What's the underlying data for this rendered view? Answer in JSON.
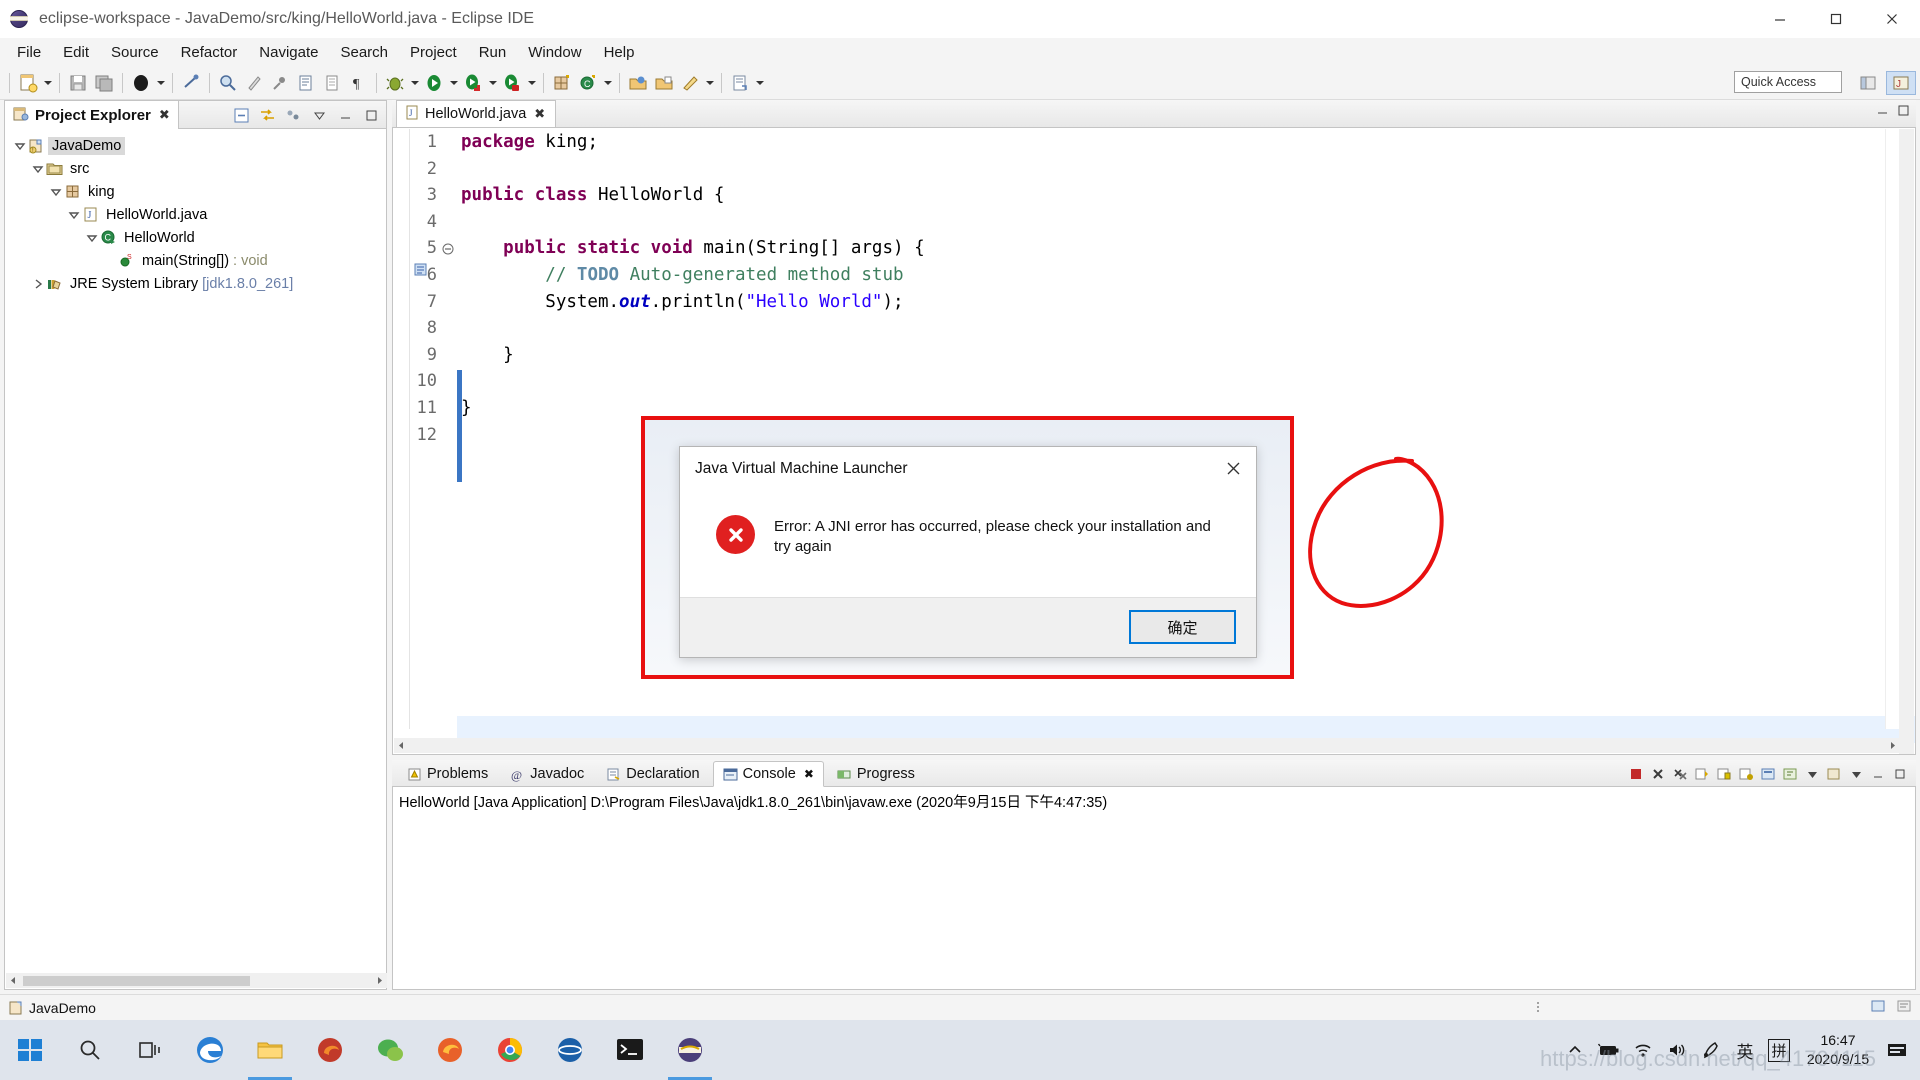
{
  "window": {
    "title": "eclipse-workspace - JavaDemo/src/king/HelloWorld.java - Eclipse IDE",
    "minimize": "–",
    "maximize": "❐",
    "close": "✕"
  },
  "menubar": {
    "items": [
      "File",
      "Edit",
      "Source",
      "Refactor",
      "Navigate",
      "Search",
      "Project",
      "Run",
      "Window",
      "Help"
    ]
  },
  "toolbar": {
    "quick_access": "Quick Access"
  },
  "project_explorer": {
    "tab_label": "Project Explorer",
    "close_glyph": "✖",
    "tree": [
      {
        "label": "JavaDemo",
        "indent": 0,
        "icon": "java-project-icon",
        "expanded": true,
        "selected": true
      },
      {
        "label": "src",
        "indent": 1,
        "icon": "source-folder-icon",
        "expanded": true,
        "selected": false
      },
      {
        "label": "king",
        "indent": 2,
        "icon": "package-icon",
        "expanded": true,
        "selected": false
      },
      {
        "label": "HelloWorld.java",
        "indent": 3,
        "icon": "java-file-icon",
        "expanded": true,
        "selected": false
      },
      {
        "label": "HelloWorld",
        "indent": 4,
        "icon": "java-class-icon",
        "expanded": true,
        "selected": false
      },
      {
        "label": "main(String[])",
        "suffix": " : void",
        "indent": 5,
        "icon": "method-static-icon",
        "expanded": null,
        "selected": false
      },
      {
        "label": "JRE System Library ",
        "suffix": "[jdk1.8.0_261]",
        "indent": 1,
        "icon": "library-icon",
        "expanded": false,
        "selected": false
      }
    ]
  },
  "editor": {
    "tab_label": "HelloWorld.java",
    "close_glyph": "✖",
    "lines": [
      {
        "n": "1",
        "html": "<span class='kw'>package</span> king;"
      },
      {
        "n": "2",
        "html": ""
      },
      {
        "n": "3",
        "html": "<span class='kw'>public class</span> HelloWorld {"
      },
      {
        "n": "4",
        "html": ""
      },
      {
        "n": "5",
        "html": "    <span class='kw'>public static void</span> main(String[] args) {"
      },
      {
        "n": "6",
        "html": "        <span class='cm'>// </span><span class='todo'>TODO</span><span class='cm'> Auto-generated method stub</span>"
      },
      {
        "n": "7",
        "html": "        System.<span class='fld'>out</span>.println(<span class='str'>\"Hello World\"</span>);"
      },
      {
        "n": "8",
        "html": ""
      },
      {
        "n": "9",
        "html": "    }"
      },
      {
        "n": "10",
        "html": ""
      },
      {
        "n": "11",
        "html": "}"
      },
      {
        "n": "12",
        "html": ""
      }
    ]
  },
  "bottom_panel": {
    "tabs": [
      {
        "label": "Problems",
        "icon": "problems-icon",
        "active": false
      },
      {
        "label": "Javadoc",
        "icon": "javadoc-icon",
        "active": false
      },
      {
        "label": "Declaration",
        "icon": "declaration-icon",
        "active": false
      },
      {
        "label": "Console",
        "icon": "console-icon",
        "active": true
      },
      {
        "label": "Progress",
        "icon": "progress-icon",
        "active": false
      }
    ],
    "console_close_glyph": "✖",
    "console_line": "HelloWorld [Java Application] D:\\Program Files\\Java\\jdk1.8.0_261\\bin\\javaw.exe (2020年9月15日 下午4:47:35)"
  },
  "statusbar": {
    "project": "JavaDemo"
  },
  "dialog": {
    "title": "Java Virtual Machine Launcher",
    "close_glyph": "✕",
    "message": "Error: A JNI error has occurred, please check your installation and try again",
    "ok_label": "确定",
    "error_icon": "error-circle-icon"
  },
  "taskbar": {
    "buttons": [
      {
        "name": "start-button",
        "icon": "windows-logo-icon"
      },
      {
        "name": "search-button",
        "icon": "search-icon"
      },
      {
        "name": "task-view-button",
        "icon": "task-view-icon"
      },
      {
        "name": "edge-button",
        "icon": "edge-icon"
      },
      {
        "name": "file-explorer-button",
        "icon": "folder-icon"
      },
      {
        "name": "firefox-quantum-button",
        "icon": "browser-icon"
      },
      {
        "name": "wechat-button",
        "icon": "wechat-icon"
      },
      {
        "name": "firefox-button",
        "icon": "firefox-icon"
      },
      {
        "name": "chrome-button",
        "icon": "chrome-icon"
      },
      {
        "name": "netease-button",
        "icon": "netease-icon"
      },
      {
        "name": "terminal-button",
        "icon": "terminal-icon"
      },
      {
        "name": "eclipse-button",
        "icon": "eclipse-icon"
      }
    ],
    "tray": {
      "chevron": "⌃",
      "battery": "battery-icon",
      "wifi": "wifi-icon",
      "volume": "speaker-icon",
      "pen": "pen-icon",
      "ime_lang": "英",
      "ime_mode": "拼",
      "time": "16:47",
      "date": "2020/9/15",
      "notifications": "notification-icon"
    }
  },
  "colors": {
    "annotation_red": "#e81010",
    "accent_blue": "#0078d7",
    "error_red": "#e02020",
    "keyword": "#7f0055",
    "string": "#2a00ff",
    "comment": "#3f7f5f"
  }
}
